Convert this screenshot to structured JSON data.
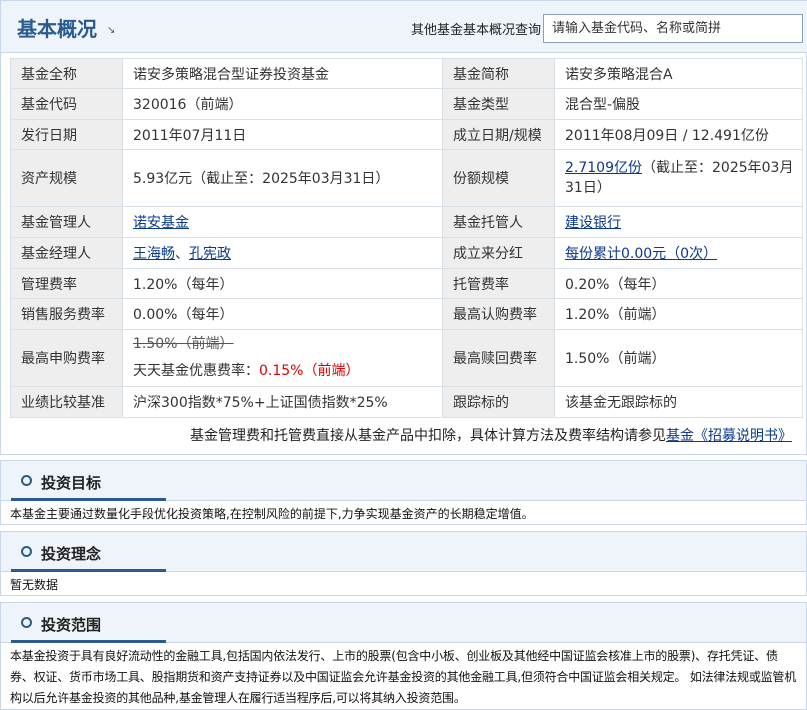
{
  "header": {
    "title": "基本概况",
    "title_arrow": "↘",
    "search_label": "其他基金基本概况查询：",
    "search_placeholder": "请输入基金代码、名称或简拼"
  },
  "info": {
    "full_name_label": "基金全称",
    "full_name": "诺安多策略混合型证券投资基金",
    "short_name_label": "基金简称",
    "short_name": "诺安多策略混合A",
    "code_label": "基金代码",
    "code": "320016（前端）",
    "type_label": "基金类型",
    "type": "混合型-偏股",
    "issue_date_label": "发行日期",
    "issue_date": "2011年07月11日",
    "est_label": "成立日期/规模",
    "est_value": "2011年08月09日 / 12.491亿份",
    "asset_label": "资产规模",
    "asset_value": "5.93亿元（截止至：2025年03月31日）",
    "share_label": "份额规模",
    "share_link": "2.7109亿份",
    "share_suffix": "（截止至：2025年03月31日）",
    "manager_co_label": "基金管理人",
    "manager_co": "诺安基金",
    "custodian_label": "基金托管人",
    "custodian": "建设银行",
    "managers_label": "基金经理人",
    "manager_1": "王海畅",
    "manager_sep": "、",
    "manager_2": "孔宪政",
    "dividend_label": "成立来分红",
    "dividend": "每份累计0.00元（0次）",
    "mgmt_fee_label": "管理费率",
    "mgmt_fee": "1.20%（每年）",
    "cust_fee_label": "托管费率",
    "cust_fee": "0.20%（每年）",
    "sales_fee_label": "销售服务费率",
    "sales_fee": "0.00%（每年）",
    "max_sub_label": "最高认购费率",
    "max_sub": "1.20%（前端）",
    "max_purchase_label": "最高申购费率",
    "max_purchase_orig": "1.50%（前端）",
    "max_purchase_disc_label": "天天基金优惠费率：",
    "max_purchase_disc": "0.15%（前端）",
    "max_redeem_label": "最高赎回费率",
    "max_redeem": "1.50%（前端）",
    "benchmark_label": "业绩比较基准",
    "benchmark": "沪深300指数*75%+上证国债指数*25%",
    "tracking_label": "跟踪标的",
    "tracking": "该基金无跟踪标的"
  },
  "fee_note": {
    "text": "基金管理费和托管费直接从基金产品中扣除，具体计算方法及费率结构请参见",
    "link": "基金《招募说明书》"
  },
  "sections": {
    "objective_title": "投资目标",
    "objective_body": "本基金主要通过数量化手段优化投资策略,在控制风险的前提下,力争实现基金资产的长期稳定增值。",
    "philosophy_title": "投资理念",
    "philosophy_body": "暂无数据",
    "scope_title": "投资范围",
    "scope_body": "本基金投资于具有良好流动性的金融工具,包括国内依法发行、上市的股票(包含中小板、创业板及其他经中国证监会核准上市的股票)、存托凭证、债券、权证、货币市场工具、股指期货和资产支持证券以及中国证监会允许基金投资的其他金融工具,但须符合中国证监会相关规定。 如法律法规或监管机构以后允许基金投资的其他品种,基金管理人在履行适当程序后,可以将其纳入投资范围。"
  }
}
